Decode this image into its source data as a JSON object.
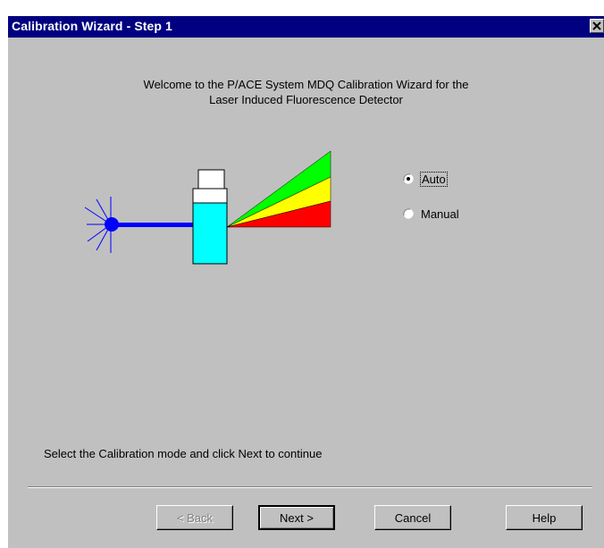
{
  "window": {
    "title": "Calibration Wizard - Step 1",
    "close_symbol": "×"
  },
  "welcome": {
    "line1": "Welcome to the P/ACE System MDQ Calibration Wizard for the",
    "line2": "Laser Induced Fluorescence Detector"
  },
  "mode": {
    "options": [
      {
        "label": "Auto",
        "selected": true
      },
      {
        "label": "Manual",
        "selected": false
      }
    ]
  },
  "instruction": "Select the Calibration mode and click Next to continue",
  "buttons": {
    "back": "< Back",
    "next": "Next >",
    "cancel": "Cancel",
    "help": "Help"
  },
  "colors": {
    "title_bar": "#000080",
    "dialog_bg": "#c0c0c0",
    "laser": "#0000ff",
    "cuvette": "#00ffff",
    "beam_green": "#00ff00",
    "beam_yellow": "#ffff00",
    "beam_red": "#ff0000"
  },
  "icons": {
    "laser_source": "laser-source-icon",
    "cuvette": "cuvette-icon",
    "fluorescence": "fluorescence-beam-icon"
  }
}
